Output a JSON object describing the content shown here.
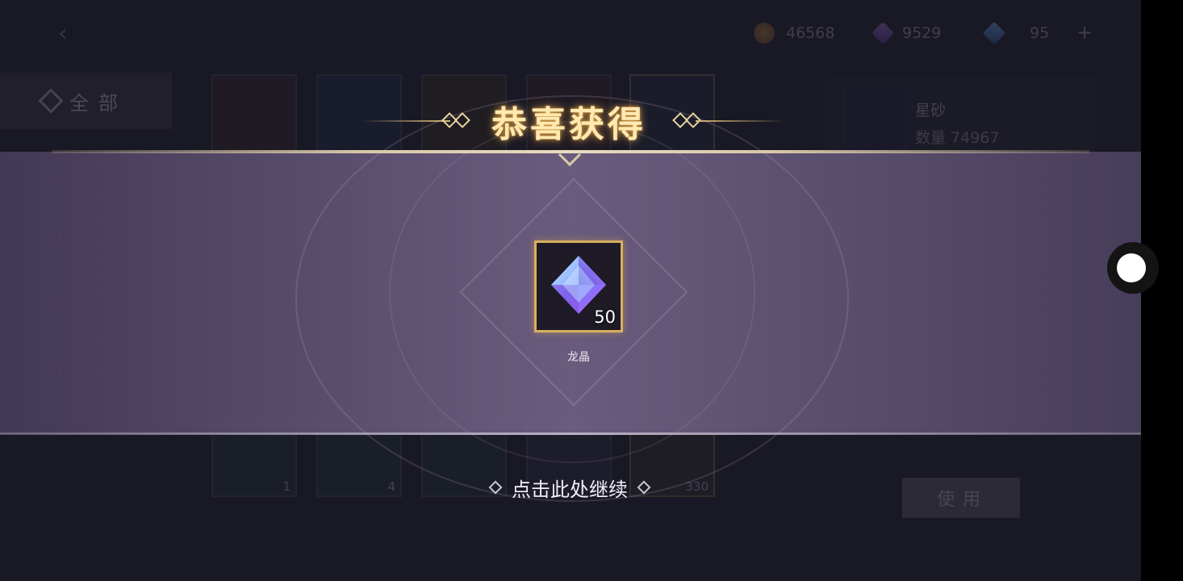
{
  "currencies": [
    {
      "icon": "gold-coin-icon",
      "value": "46568"
    },
    {
      "icon": "purple-gem-icon",
      "value": "9529"
    },
    {
      "icon": "blue-crystal-icon",
      "value": "95"
    }
  ],
  "plus_label": "+",
  "back_icon": "‹",
  "sidebar": {
    "all_label": "全部",
    "items": [
      {
        "label": "",
        "icon": "category-icon"
      },
      {
        "label": "",
        "icon": "building-icon"
      },
      {
        "label": "",
        "icon": "person-icon"
      },
      {
        "label": "",
        "icon": "chart-icon"
      }
    ]
  },
  "inventory": {
    "row1_counts": [
      "",
      "",
      "",
      "",
      ""
    ],
    "row2_counts": [
      "1",
      "4",
      "",
      "",
      "330"
    ]
  },
  "detail": {
    "name": "星砂",
    "quantity": "数量 74967",
    "use_label": "使用"
  },
  "popup": {
    "title": "恭喜获得",
    "reward": {
      "name": "龙晶",
      "quantity": "50",
      "icon": "dragon-crystal-icon"
    },
    "continue_label": "点击此处继续"
  },
  "colors": {
    "accent_gold": "#d8b060",
    "banner": "#6e5f82"
  }
}
